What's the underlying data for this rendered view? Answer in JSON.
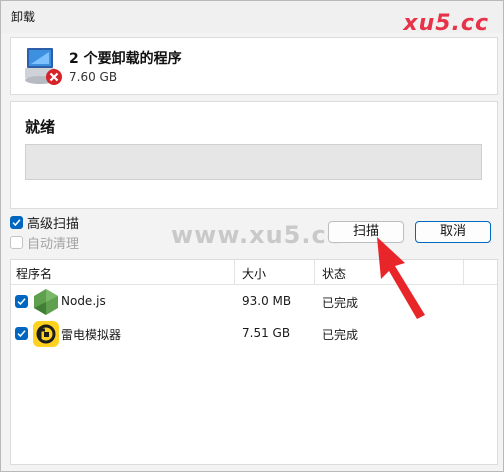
{
  "window": {
    "title": "卸载",
    "watermark_top": "xu5.cc"
  },
  "header": {
    "title": "2 个要卸载的程序",
    "size": "7.60 GB",
    "icon": "uninstall-computer-icon"
  },
  "status": {
    "label": "就绪",
    "progress": 0
  },
  "options": {
    "advanced_scan": {
      "label": "高级扫描",
      "checked": true,
      "enabled": true
    },
    "auto_clean": {
      "label": "自动清理",
      "checked": false,
      "enabled": false
    }
  },
  "buttons": {
    "scan": "扫描",
    "cancel": "取消"
  },
  "watermark_mid": "www.xu5.cc",
  "table": {
    "columns": [
      "程序名",
      "大小",
      "状态"
    ],
    "rows": [
      {
        "name": "Node.js",
        "size": "93.0 MB",
        "status": "已完成",
        "checked": true,
        "icon": "nodejs-icon"
      },
      {
        "name": "雷电模拟器",
        "size": "7.51 GB",
        "status": "已完成",
        "checked": true,
        "icon": "ldplayer-icon"
      }
    ]
  },
  "colors": {
    "accent": "#0067c0",
    "arrow": "#e8262a",
    "watermark": "#e7334a"
  }
}
